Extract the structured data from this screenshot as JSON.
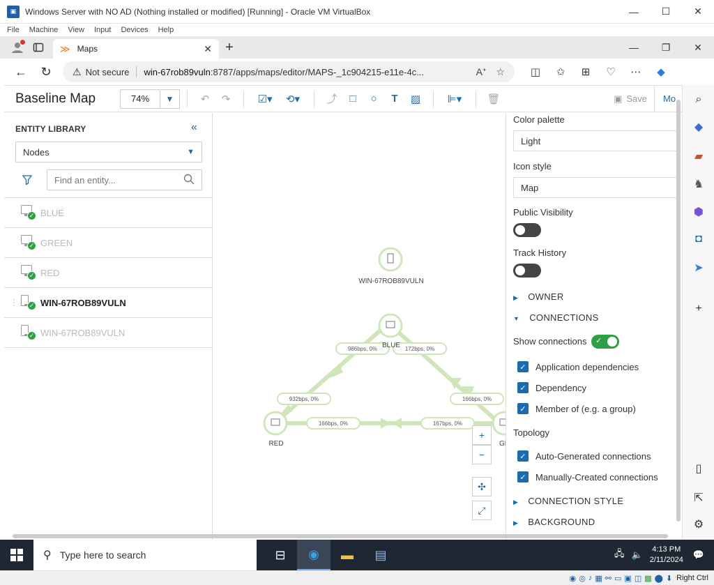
{
  "vbox": {
    "title": "Windows Server with NO AD (Nothing installed or modified) [Running] - Oracle VM VirtualBox",
    "menu": [
      "File",
      "Machine",
      "View",
      "Input",
      "Devices",
      "Help"
    ],
    "host_key": "Right Ctrl"
  },
  "browser": {
    "tab_title": "Maps",
    "security_label": "Not secure",
    "url_host": "win-67rob89vuln",
    "url_rest": ":8787/apps/maps/editor/MAPS-_1c904215-e11e-4c..."
  },
  "toolbar": {
    "map_title": "Baseline Map",
    "zoom": "74%",
    "save_label": "Save",
    "more_label": "Mo"
  },
  "library": {
    "heading": "ENTITY LIBRARY",
    "type_select": "Nodes",
    "search_placeholder": "Find an entity...",
    "items": [
      {
        "label": "BLUE"
      },
      {
        "label": "GREEN"
      },
      {
        "label": "RED"
      },
      {
        "label": "WIN-67ROB89VULN"
      },
      {
        "label": "WIN-67ROB89VULN"
      }
    ]
  },
  "map": {
    "nodes": {
      "win": "WIN-67ROB89VULN",
      "blue": "BLUE",
      "red": "RED",
      "green": "GRE"
    },
    "links": {
      "blue_red": "986bps, 0%",
      "blue_green": "172bps, 0%",
      "red_blue": "932bps, 0%",
      "green_blue": "166bps, 0%",
      "red_green": "166bps, 0%",
      "green_red": "167bps, 0%"
    },
    "zoom_in": "+",
    "zoom_out": "−"
  },
  "props": {
    "color_palette_label": "Color palette",
    "color_palette_value": "Light",
    "icon_style_label": "Icon style",
    "icon_style_value": "Map",
    "public_visibility_label": "Public Visibility",
    "track_history_label": "Track History",
    "owner_section": "OWNER",
    "connections_section": "CONNECTIONS",
    "show_connections_label": "Show connections",
    "conn_types": [
      "Application dependencies",
      "Dependency",
      "Member of (e.g. a group)"
    ],
    "topology_label": "Topology",
    "topology_types": [
      "Auto-Generated connections",
      "Manually-Created connections"
    ],
    "connection_style_section": "CONNECTION STYLE",
    "background_section": "BACKGROUND"
  },
  "taskbar": {
    "search_placeholder": "Type here to search",
    "time": "4:13 PM",
    "date": "2/11/2024"
  },
  "colors": {
    "accent": "#1a6bb0",
    "node_green": "#cfe6b8",
    "status_ok": "#2ea043",
    "taskbar": "#1f2733"
  }
}
